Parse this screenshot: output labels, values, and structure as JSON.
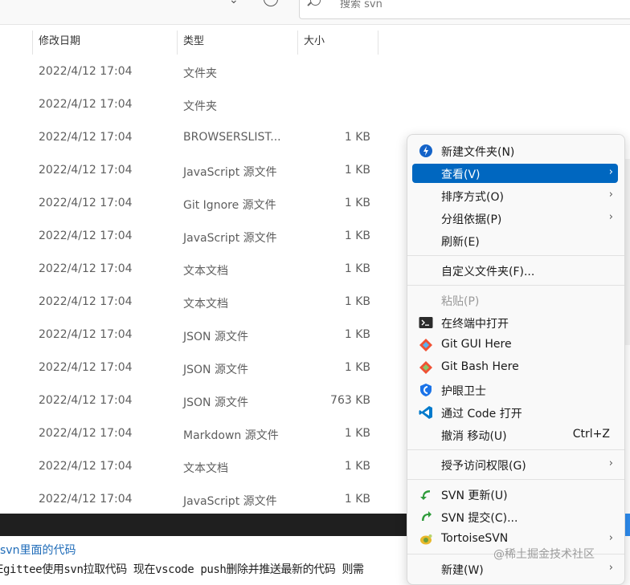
{
  "toolbar": {
    "search_placeholder": "搜索 svn"
  },
  "columns": [
    "修改日期",
    "类型",
    "大小"
  ],
  "files": [
    {
      "date": "2022/4/12 17:04",
      "type": "文件夹",
      "size": ""
    },
    {
      "date": "2022/4/12 17:04",
      "type": "文件夹",
      "size": ""
    },
    {
      "date": "2022/4/12 17:04",
      "type": "BROWSERSLIST...",
      "size": "1 KB"
    },
    {
      "date": "2022/4/12 17:04",
      "type": "JavaScript 源文件",
      "size": "1 KB"
    },
    {
      "date": "2022/4/12 17:04",
      "type": "Git Ignore 源文件",
      "size": "1 KB"
    },
    {
      "date": "2022/4/12 17:04",
      "type": "JavaScript 源文件",
      "size": "1 KB"
    },
    {
      "date": "2022/4/12 17:04",
      "type": "文本文档",
      "size": "1 KB"
    },
    {
      "date": "2022/4/12 17:04",
      "type": "文本文档",
      "size": "1 KB"
    },
    {
      "date": "2022/4/12 17:04",
      "type": "JSON 源文件",
      "size": "1 KB"
    },
    {
      "date": "2022/4/12 17:04",
      "type": "JSON 源文件",
      "size": "1 KB"
    },
    {
      "date": "2022/4/12 17:04",
      "type": "JSON 源文件",
      "size": "763 KB"
    },
    {
      "date": "2022/4/12 17:04",
      "type": "Markdown 源文件",
      "size": "1 KB"
    },
    {
      "date": "2022/4/12 17:04",
      "type": "文本文档",
      "size": "1 KB"
    },
    {
      "date": "2022/4/12 17:04",
      "type": "JavaScript 源文件",
      "size": "1 KB"
    }
  ],
  "context_menu": {
    "new_folder": "新建文件夹(N)",
    "view": "查看(V)",
    "sort_by": "排序方式(O)",
    "group_by": "分组依据(P)",
    "refresh": "刷新(E)",
    "customize_folder": "自定义文件夹(F)...",
    "paste": "粘贴(P)",
    "open_in_terminal": "在终端中打开",
    "git_gui": "Git GUI Here",
    "git_bash": "Git Bash Here",
    "eye_guard": "护眼卫士",
    "open_with_code": "通过 Code 打开",
    "undo_move": "撤消 移动(U)",
    "undo_shortcut": "Ctrl+Z",
    "grant_access": "授予访问权限(G)",
    "svn_update": "SVN 更新(U)",
    "svn_commit": "SVN 提交(C)...",
    "tortoise": "TortoiseSVN",
    "new": "新建(W)"
  },
  "article": {
    "heading": "svn里面的代码",
    "line": "Egittee使用svn拉取代码 现在vscode push删除并推送最新的代码 则需"
  },
  "watermark": "@稀土掘金技术社区",
  "colors": {
    "accent": "#0067c0",
    "row_text": "#5e5e5e",
    "link": "#1e6bb8"
  }
}
